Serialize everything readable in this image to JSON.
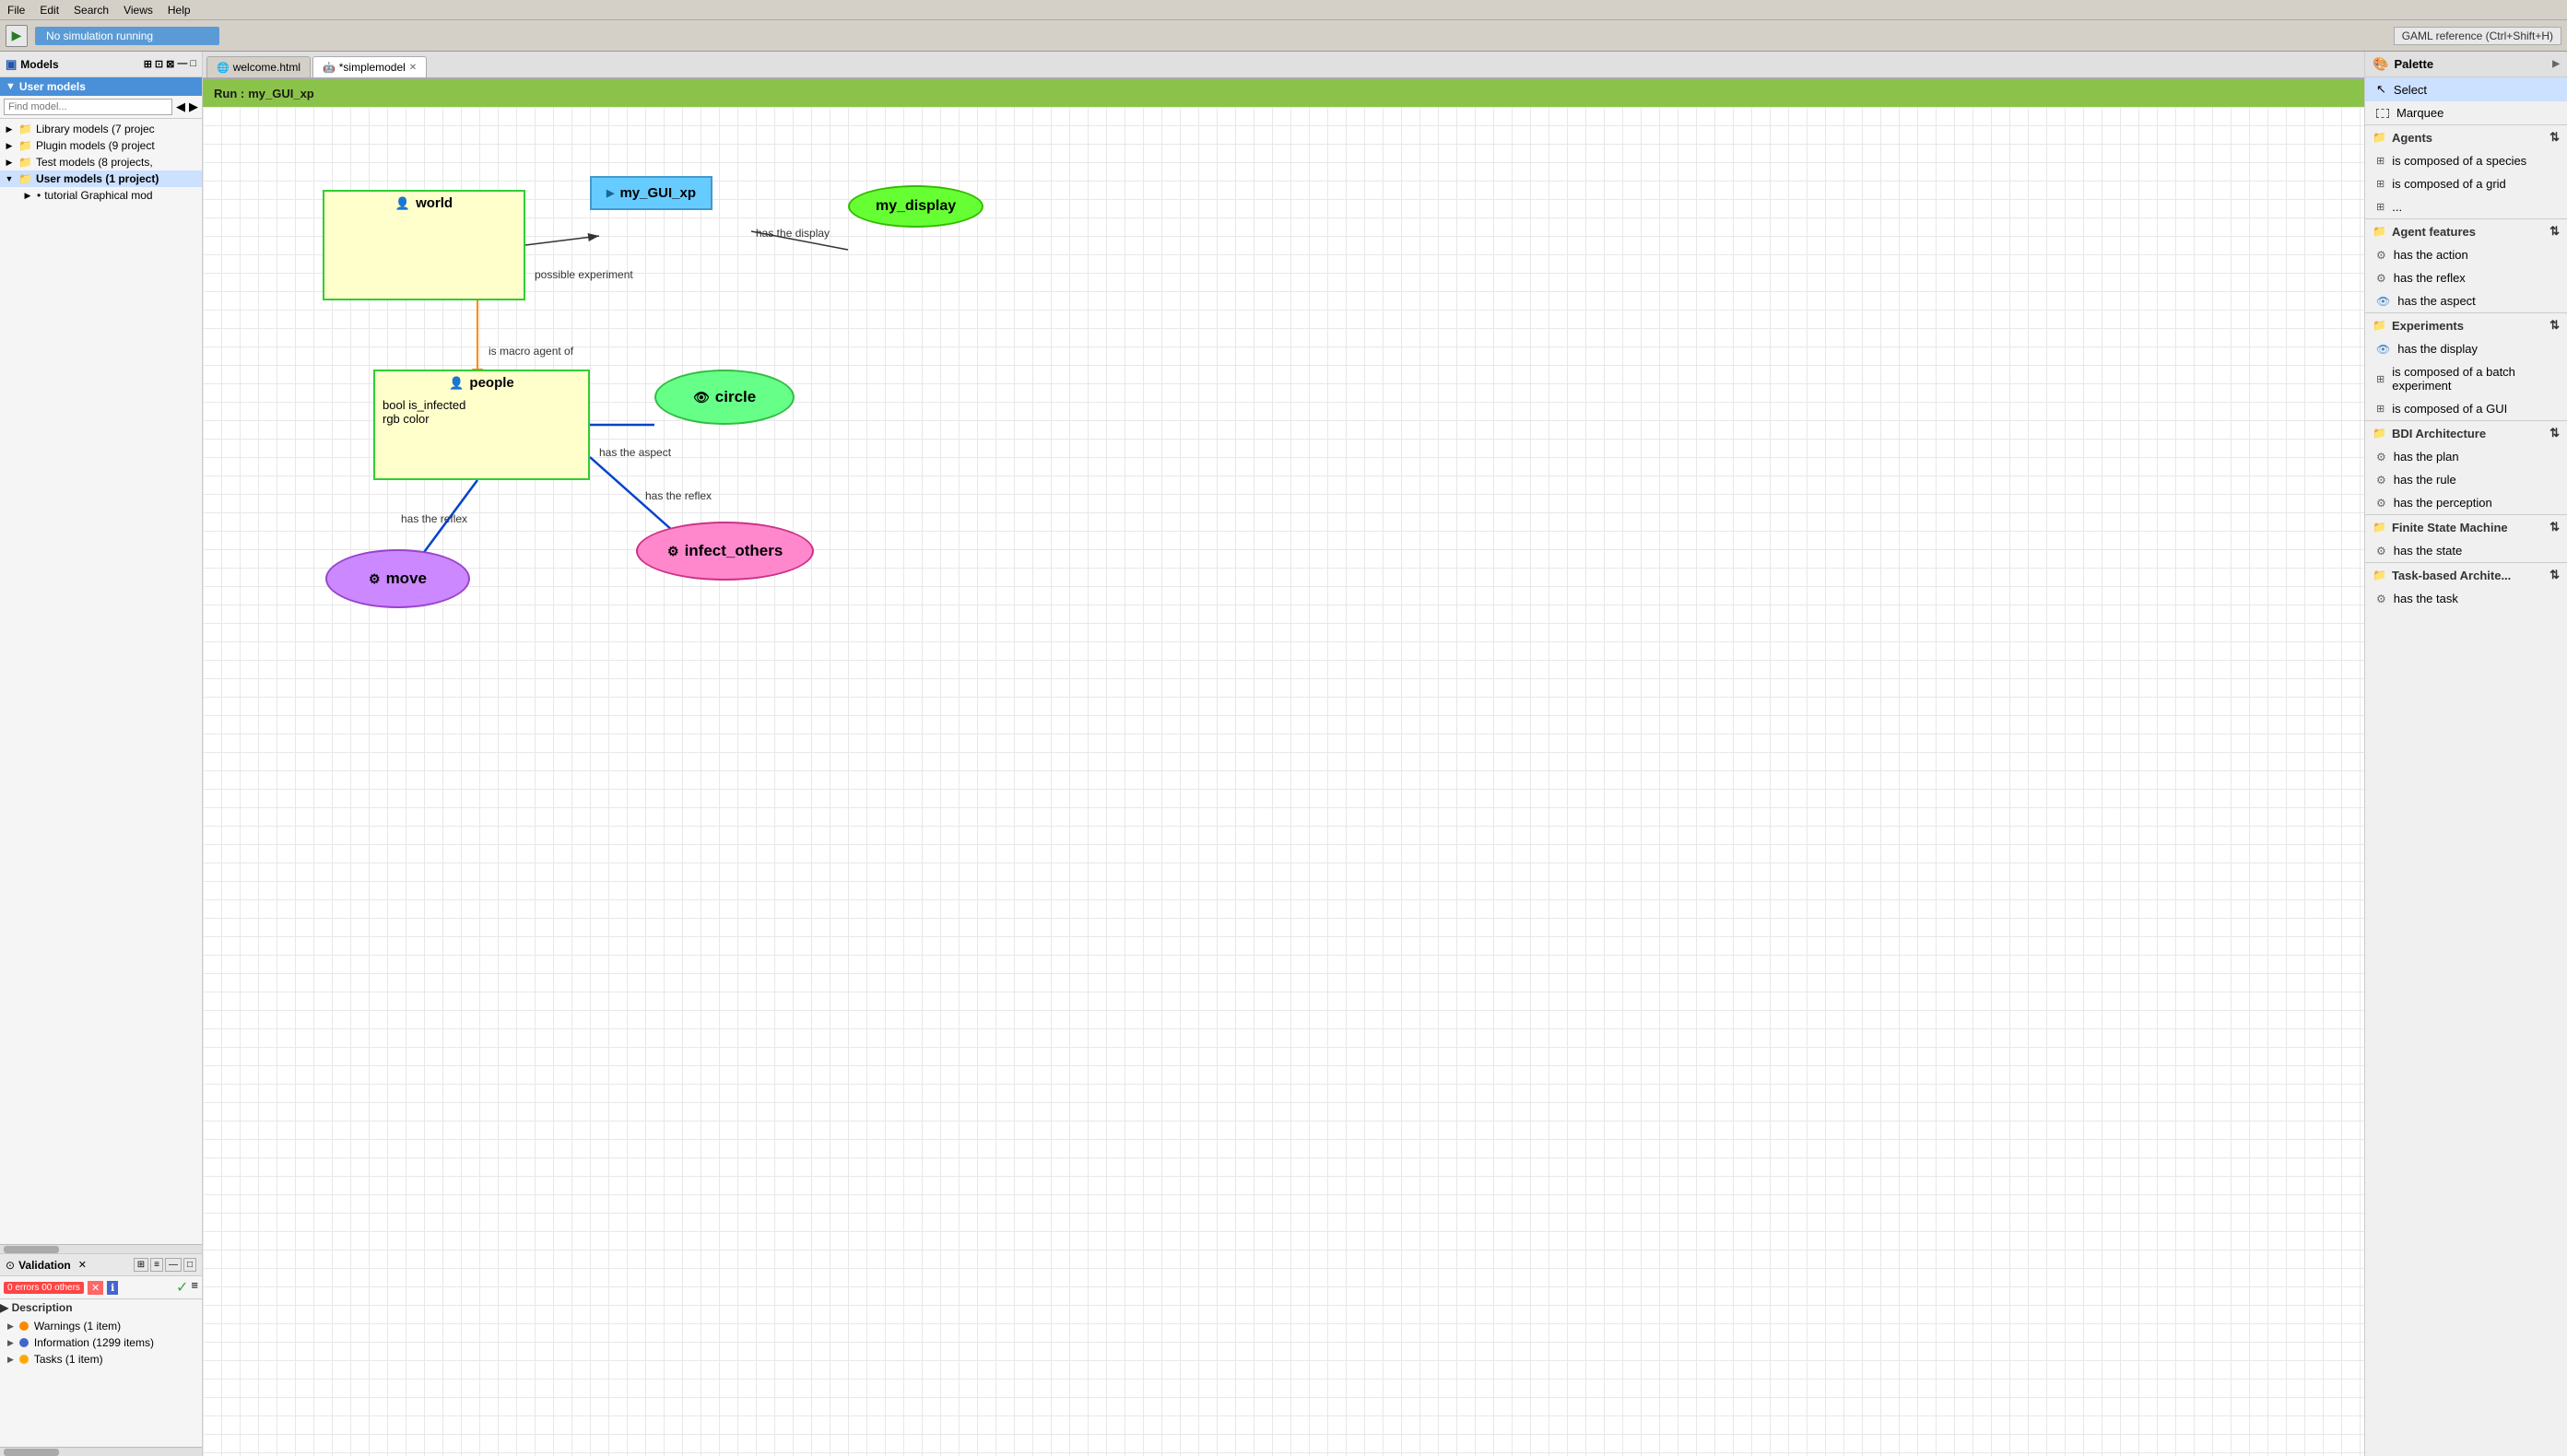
{
  "menubar": {
    "items": [
      "File",
      "Edit",
      "Search",
      "Views",
      "Help"
    ]
  },
  "toolbar": {
    "sim_status": "No simulation running",
    "gaml_ref": "GAML reference (Ctrl+Shift+H)"
  },
  "tabs": [
    {
      "label": "welcome.html",
      "active": false,
      "closable": false
    },
    {
      "label": "*simplemodel",
      "active": true,
      "closable": true
    }
  ],
  "run_bar": {
    "label": "Run :",
    "experiment": "my_GUI_xp"
  },
  "left_panel": {
    "models_title": "Models",
    "find_placeholder": "Find model...",
    "tree": [
      {
        "label": "Library models (7 projec",
        "type": "lib",
        "expanded": false
      },
      {
        "label": "Plugin models (9 project",
        "type": "plugin",
        "expanded": false
      },
      {
        "label": "Test models (8 projects,",
        "type": "test",
        "expanded": false
      },
      {
        "label": "User models (1 project)",
        "type": "user",
        "expanded": true
      },
      {
        "label": "tutorial Graphical mod",
        "type": "sub",
        "expanded": false
      }
    ]
  },
  "validation": {
    "title": "Validation",
    "filter_label": "0 errors   00 others",
    "description_label": "Description",
    "items": [
      {
        "type": "warning",
        "label": "Warnings (1 item)"
      },
      {
        "type": "info",
        "label": "Information (1299 items)"
      },
      {
        "type": "task",
        "label": "Tasks (1 item)"
      }
    ]
  },
  "diagram": {
    "nodes": {
      "world": {
        "label": "world"
      },
      "gui": {
        "label": "my_GUI_xp"
      },
      "display": {
        "label": "my_display"
      },
      "people": {
        "label": "people",
        "attributes": [
          "bool is_infected",
          "rgb color"
        ]
      },
      "circle": {
        "label": "circle"
      },
      "move": {
        "label": "move"
      },
      "infect": {
        "label": "infect_others"
      }
    },
    "edges": {
      "world_gui": "possible experiment",
      "gui_display": "has the display",
      "world_people": "is macro agent of",
      "people_circle": "has the aspect",
      "people_move": "has the reflex",
      "people_infect": "has the reflex"
    }
  },
  "palette": {
    "title": "Palette",
    "sections": [
      {
        "name": "top",
        "items": [
          {
            "label": "Select",
            "icon": "cursor"
          },
          {
            "label": "Marquee",
            "icon": "marquee"
          }
        ]
      },
      {
        "name": "Agents",
        "items": [
          {
            "label": "is composed of a species",
            "icon": "grid"
          },
          {
            "label": "is composed of a grid",
            "icon": "grid"
          },
          {
            "label": "...",
            "icon": "grid"
          }
        ]
      },
      {
        "name": "Agent features",
        "items": [
          {
            "label": "has the action",
            "icon": "gear"
          },
          {
            "label": "has the reflex",
            "icon": "gear"
          },
          {
            "label": "has the aspect",
            "icon": "eye"
          }
        ]
      },
      {
        "name": "Experiments",
        "items": [
          {
            "label": "has the display",
            "icon": "eye"
          },
          {
            "label": "is composed of a batch experiment",
            "icon": "grid"
          },
          {
            "label": "is composed of a GUI",
            "icon": "grid"
          }
        ]
      },
      {
        "name": "BDI Architecture",
        "items": [
          {
            "label": "has the plan",
            "icon": "gear"
          },
          {
            "label": "has the rule",
            "icon": "gear"
          },
          {
            "label": "has the perception",
            "icon": "gear"
          }
        ]
      },
      {
        "name": "Finite State Machine",
        "items": [
          {
            "label": "has the state",
            "icon": "gear"
          }
        ]
      },
      {
        "name": "Task-based Archite...",
        "items": [
          {
            "label": "has the task",
            "icon": "gear"
          }
        ]
      }
    ]
  }
}
